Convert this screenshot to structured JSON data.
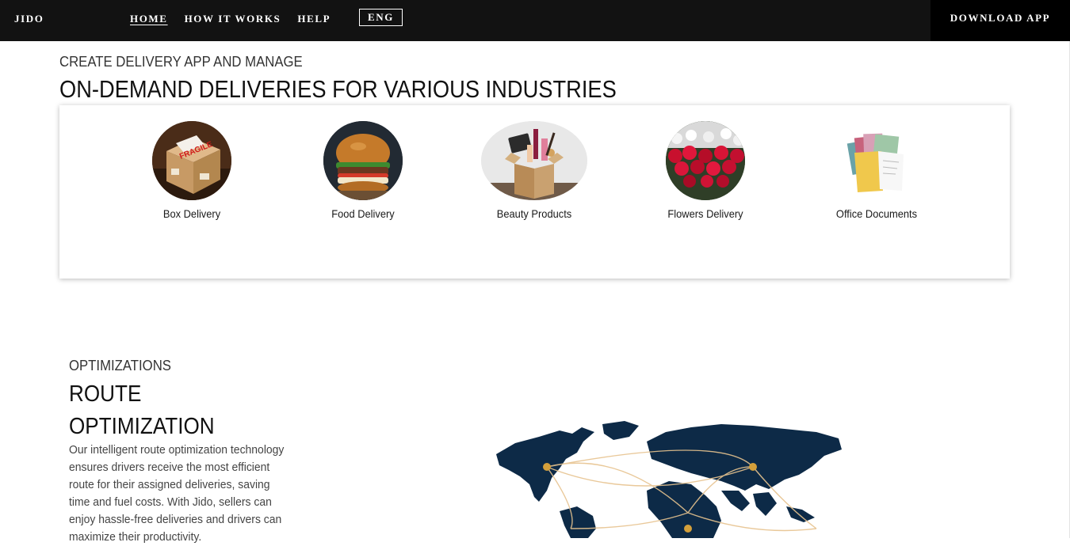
{
  "nav": {
    "brand": "JIDO",
    "links": [
      "HOME",
      "HOW IT WORKS",
      "HELP"
    ],
    "language": "ENG",
    "download": "DOWNLOAD APP"
  },
  "industries": {
    "kicker": "CREATE DELIVERY APP AND MANAGE",
    "headline": "ON-DEMAND DELIVERIES FOR VARIOUS INDUSTRIES",
    "items": [
      {
        "label": "Box Delivery",
        "icon": "fragile-box-icon"
      },
      {
        "label": "Food Delivery",
        "icon": "burger-icon"
      },
      {
        "label": "Beauty Products",
        "icon": "cosmetics-box-icon"
      },
      {
        "label": "Flowers Delivery",
        "icon": "roses-icon"
      },
      {
        "label": "Office Documents",
        "icon": "folders-icon"
      }
    ]
  },
  "optimization": {
    "kicker": "OPTIMIZATIONS",
    "title": "ROUTE OPTIMIZATION",
    "body": "Our intelligent route optimization technology ensures drivers receive the most efficient route for their assigned deliveries, saving time and fuel costs. With Jido, sellers can enjoy hassle-free deliveries and drivers can maximize their productivity."
  },
  "colors": {
    "nav_bg": "#121212",
    "map_fill": "#0d2a47",
    "route_color": "#e7c38f",
    "hub_color": "#d4a03b"
  }
}
